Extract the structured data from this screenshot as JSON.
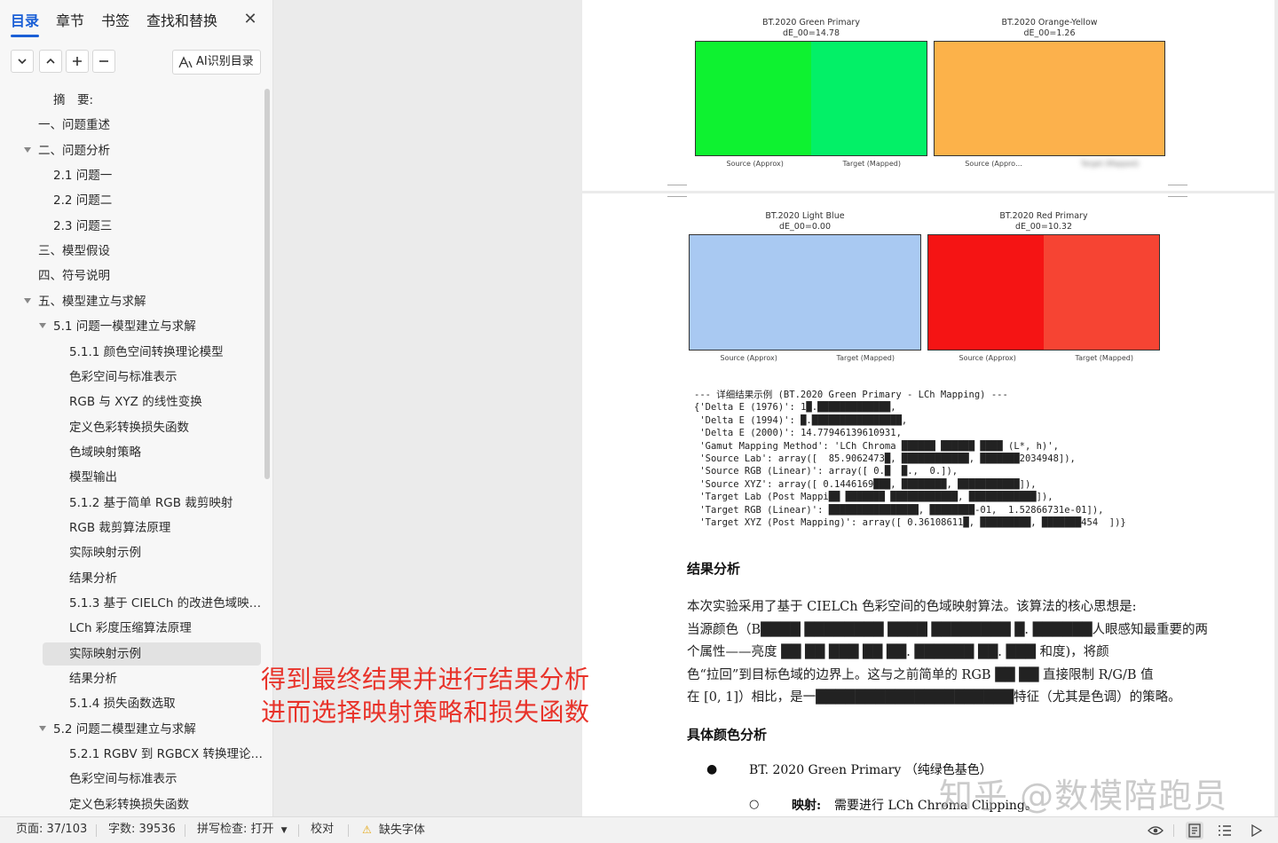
{
  "nav": {
    "tabs": [
      "目录",
      "章节",
      "书签",
      "查找和替换"
    ],
    "active_tab": 0,
    "ai_button_label": "AI识别目录",
    "toc": [
      {
        "label": "摘　要:",
        "level": 1,
        "expander": false
      },
      {
        "label": "一、问题重述",
        "level": 0,
        "expander": false
      },
      {
        "label": "二、问题分析",
        "level": 0,
        "expander": true
      },
      {
        "label": "2.1 问题一",
        "level": 1,
        "expander": false
      },
      {
        "label": "2.2 问题二",
        "level": 1,
        "expander": false
      },
      {
        "label": "2.3 问题三",
        "level": 1,
        "expander": false
      },
      {
        "label": "三、模型假设",
        "level": 0,
        "expander": false
      },
      {
        "label": "四、符号说明",
        "level": 0,
        "expander": false
      },
      {
        "label": "五、模型建立与求解",
        "level": 0,
        "expander": true
      },
      {
        "label": "5.1 问题一模型建立与求解",
        "level": 1,
        "expander": true
      },
      {
        "label": "5.1.1  颜色空间转换理论模型",
        "level": 2,
        "expander": false
      },
      {
        "label": "色彩空间与标准表示",
        "level": 2,
        "expander": false
      },
      {
        "label": "RGB  与  XYZ  的线性变换",
        "level": 2,
        "expander": false
      },
      {
        "label": "定义色彩转换损失函数",
        "level": 2,
        "expander": false
      },
      {
        "label": "色域映射策略",
        "level": 2,
        "expander": false
      },
      {
        "label": "模型输出",
        "level": 2,
        "expander": false
      },
      {
        "label": "5.1.2  基于简单  RGB  裁剪映射",
        "level": 2,
        "expander": false
      },
      {
        "label": "RGB  裁剪算法原理",
        "level": 2,
        "expander": false
      },
      {
        "label": "实际映射示例",
        "level": 2,
        "expander": false
      },
      {
        "label": "结果分析",
        "level": 2,
        "expander": false
      },
      {
        "label": "5.1.3  基于  CIELCh  的改进色域映…",
        "level": 2,
        "expander": false
      },
      {
        "label": "LCh  彩度压缩算法原理",
        "level": 2,
        "expander": false
      },
      {
        "label": "实际映射示例",
        "level": 2,
        "expander": false,
        "selected": true
      },
      {
        "label": "结果分析",
        "level": 2,
        "expander": false
      },
      {
        "label": "5.1.4  损失函数选取",
        "level": 2,
        "expander": false
      },
      {
        "label": "5.2 问题二模型建立与求解",
        "level": 1,
        "expander": true
      },
      {
        "label": "5.2.1 RGBV 到 RGBCX 转换理论…",
        "level": 2,
        "expander": false
      },
      {
        "label": "色彩空间与标准表示",
        "level": 2,
        "expander": false
      },
      {
        "label": "定义色彩转换损失函数",
        "level": 2,
        "expander": false
      }
    ]
  },
  "doc": {
    "swatches": [
      {
        "title": "BT.2020 Green Primary",
        "de": "dE_00=14.78",
        "source_color": "#0ef230",
        "target_color": "#03f067",
        "source_label": "Source (Approx)",
        "target_label": "Target (Mapped)"
      },
      {
        "title": "BT.2020 Orange-Yellow",
        "de": "dE_00=1.26",
        "source_color": "#fcb24a",
        "target_color": "#fcb14c",
        "source_label": "Source (Appro…",
        "target_label": "Target (Mapped)"
      },
      {
        "title": "BT.2020 Light Blue",
        "de": "dE_00=0.00",
        "source_color": "#a9c9f2",
        "target_color": "#a9c9f2",
        "source_label": "Source (Approx)",
        "target_label": "Target (Mapped)"
      },
      {
        "title": "BT.2020 Red Primary",
        "de": "dE_00=10.32",
        "source_color": "#f51414",
        "target_color": "#f64433",
        "source_label": "Source (Approx)",
        "target_label": "Target (Mapped)"
      }
    ],
    "code_lines": [
      "--- 详细结果示例 (BT.2020 Green Primary - LCh Mapping) ---",
      "{'Delta E (1976)': 1█.█████████████,",
      " 'Delta E (1994)': █.████████████████,",
      " 'Delta E (2000)': 14.77946139610931,",
      " 'Gamut Mapping Method': 'LCh Chroma ██████ ██████ ████ (L*, h)',",
      " 'Source Lab': array([  85.9062473█, ████████████, ███████2034948]),",
      " 'Source RGB (Linear)': array([ 0.█  █.,  0.]),",
      " 'Source XYZ': array([ 0.1446169███, ████████, ███████████]),",
      " 'Target Lab (Post Mappi██ ███████ ████████████, ████████████]),",
      " 'Target RGB (Linear)': ████████████████, ████████-01,  1.52866731e-01]),",
      " 'Target XYZ (Post Mapping)': array([ 0.36108611█, █████████, ███████454  ])}"
    ],
    "heading_analysis": "结果分析",
    "para_lines": [
      "本次实验采用了基于 CIELCh 色彩空间的色域映射算法。该算法的核心思想是:",
      "当源颜色（B████ ████████ ████ ████████ █. ██████人眼感知最重要的两",
      "个属性——亮度 ██ ██ ███ ██  ██. ██████ ██. ███ 和度)，将颜",
      "色“拉回”到目标色域的边界上。这与之前简单的 RGB ██ ██ 直接限制 R/G/B 值",
      "在 [0, 1]）相比，是一████████████████████特征（尤其是色调）的策略。"
    ],
    "heading_colors": "具体颜色分析",
    "bullet_main": "BT. 2020 Green Primary （纯绿色基色）",
    "bullet_sub_label": "映射:",
    "bullet_sub_text": "需要进行 LCh Chroma Clipping。"
  },
  "overlay": {
    "line1": "得到最终结果并进行结果分析",
    "line2": "进而选择映射策略和损失函数"
  },
  "watermark": "知乎 @数模陪跑员",
  "status": {
    "page": "页面: 37/103",
    "words": "字数: 39536",
    "spell": "拼写检查: 打开",
    "proof": "校对",
    "missing_font": "缺失字体"
  },
  "colors": {
    "accent": "#1a5fd6",
    "overlay_red": "#e8332a",
    "warning": "#e6a817"
  }
}
